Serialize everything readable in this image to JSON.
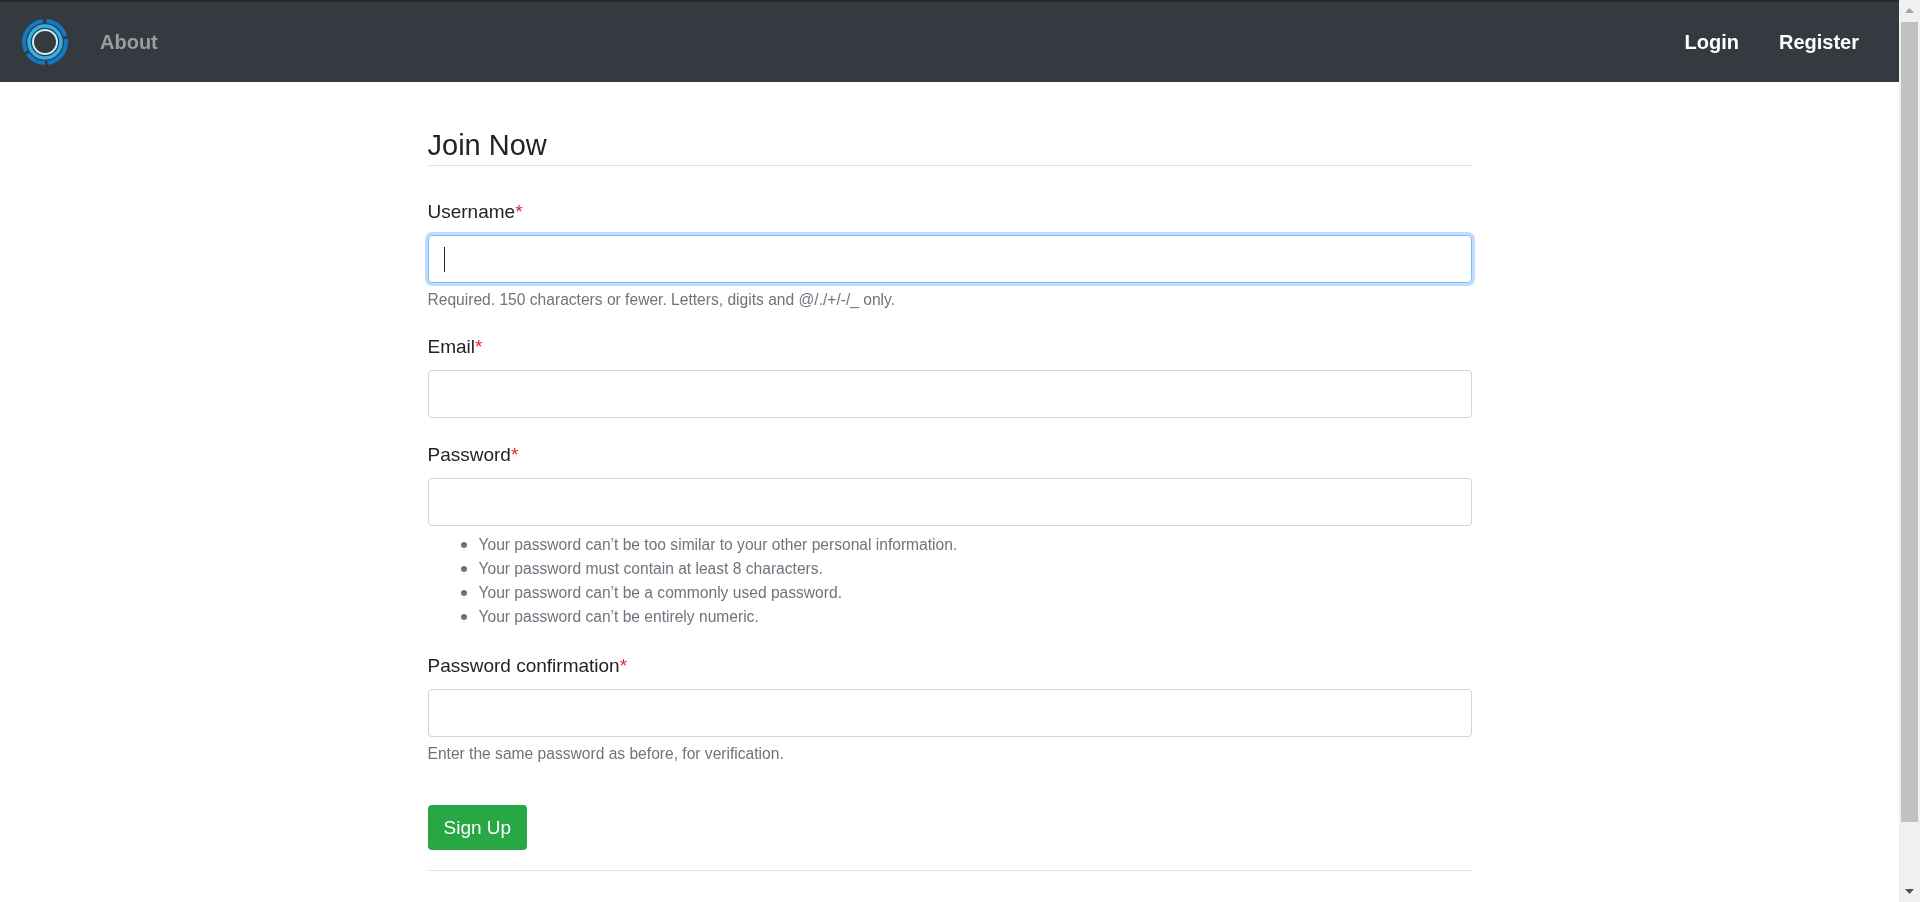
{
  "navbar": {
    "left_links": [
      {
        "label": "About"
      }
    ],
    "right_links": [
      {
        "label": "Login"
      },
      {
        "label": "Register"
      }
    ]
  },
  "form": {
    "title": "Join Now",
    "fields": [
      {
        "label": "Username",
        "required_mark": "*",
        "focused": true,
        "help": "Required. 150 characters or fewer. Letters, digits and @/./+/-/_ only."
      },
      {
        "label": "Email",
        "required_mark": "*",
        "focused": false
      },
      {
        "label": "Password",
        "required_mark": "*",
        "focused": false,
        "hints": [
          "Your password can’t be too similar to your other personal information.",
          "Your password must contain at least 8 characters.",
          "Your password can’t be a commonly used password.",
          "Your password can’t be entirely numeric."
        ]
      },
      {
        "label": "Password confirmation",
        "required_mark": "*",
        "focused": false,
        "help": "Enter the same password as before, for verification."
      }
    ],
    "submit": {
      "label": "Sign Up"
    }
  }
}
